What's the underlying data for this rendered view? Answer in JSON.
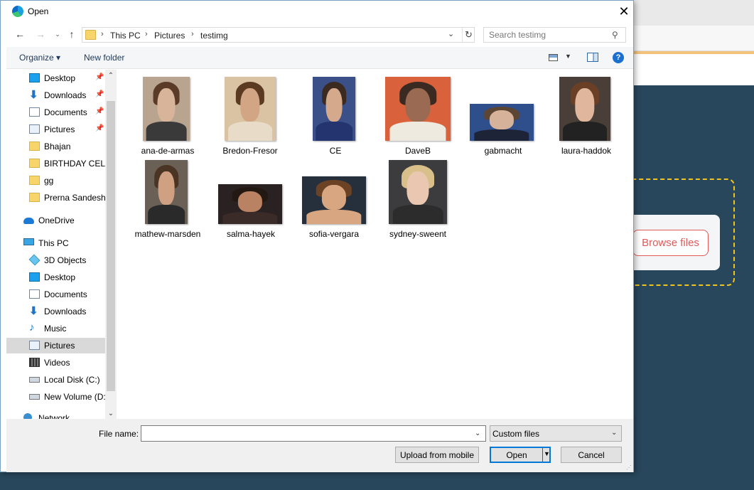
{
  "dialog": {
    "title": "Open",
    "close_glyph": "✕"
  },
  "nav": {
    "back_glyph": "←",
    "forward_glyph": "→",
    "recent_glyph": "⌄",
    "up_glyph": "↑",
    "breadcrumb": [
      "This PC",
      "Pictures",
      "testimg"
    ],
    "separator": "›",
    "dropdown_glyph": "⌄",
    "refresh_glyph": "↻",
    "search_placeholder": "Search testimg",
    "search_glyph": "⚲"
  },
  "toolbar": {
    "organize_label": "Organize ▾",
    "new_folder_label": "New folder",
    "view_dropdown_glyph": "▼",
    "help_glyph": "?"
  },
  "sidebar": {
    "pin_glyph": "📌",
    "items": [
      {
        "label": "Desktop",
        "icon": "desktop-icon",
        "pinned": true
      },
      {
        "label": "Downloads",
        "icon": "downloads-icon",
        "pinned": true
      },
      {
        "label": "Documents",
        "icon": "documents-icon",
        "pinned": true
      },
      {
        "label": "Pictures",
        "icon": "pictures-icon",
        "pinned": true
      },
      {
        "label": "Bhajan",
        "icon": "folder-icon",
        "pinned": false
      },
      {
        "label": "BIRTHDAY CELEB",
        "icon": "folder-icon",
        "pinned": false
      },
      {
        "label": "gg",
        "icon": "folder-icon",
        "pinned": false
      },
      {
        "label": "Prerna Sandesh_",
        "icon": "folder-icon",
        "pinned": false
      },
      {
        "label": "OneDrive",
        "icon": "onedrive-icon",
        "pinned": false
      },
      {
        "label": "This PC",
        "icon": "this-pc-icon",
        "pinned": false
      },
      {
        "label": "3D Objects",
        "icon": "3d-objects-icon",
        "pinned": false
      },
      {
        "label": "Desktop",
        "icon": "desktop-icon",
        "pinned": false
      },
      {
        "label": "Documents",
        "icon": "documents-icon",
        "pinned": false
      },
      {
        "label": "Downloads",
        "icon": "downloads-icon",
        "pinned": false
      },
      {
        "label": "Music",
        "icon": "music-icon",
        "pinned": false
      },
      {
        "label": "Pictures",
        "icon": "pictures-icon",
        "pinned": false,
        "selected": true
      },
      {
        "label": "Videos",
        "icon": "videos-icon",
        "pinned": false
      },
      {
        "label": "Local Disk (C:)",
        "icon": "local-disk-icon",
        "pinned": false
      },
      {
        "label": "New Volume (D:",
        "icon": "volume-icon",
        "pinned": false
      },
      {
        "label": "Network",
        "icon": "network-icon",
        "pinned": false
      }
    ],
    "scroll_up_glyph": "⌃",
    "scroll_down_glyph": "⌄"
  },
  "files": [
    {
      "name": "ana-de-armas",
      "skin": "#d8b49a",
      "hair": "#5a3b28",
      "bg": "#b9a58f",
      "cloth": "#3a3a3a"
    },
    {
      "name": "Bredon-Fresor",
      "skin": "#d2a584",
      "hair": "#5b3a22",
      "bg": "#d9c3a3",
      "cloth": "#e8dcc8"
    },
    {
      "name": "CE",
      "skin": "#d4a98c",
      "hair": "#3b2a20",
      "bg": "#3b4f88",
      "cloth": "#23346f"
    },
    {
      "name": "DaveB",
      "skin": "#9a6b52",
      "hair": "#3a2a22",
      "bg": "#d9623c",
      "cloth": "#eeeadf"
    },
    {
      "name": "gabmacht",
      "skin": "#d7b29a",
      "hair": "#5c4633",
      "bg": "#2f4f8c",
      "cloth": "#1d2438"
    },
    {
      "name": "laura-haddok",
      "skin": "#e0b79d",
      "hair": "#6a3f26",
      "bg": "#4a3f38",
      "cloth": "#222"
    },
    {
      "name": "mathew-marsden",
      "skin": "#cfa081",
      "hair": "#4a3424",
      "bg": "#6a6055",
      "cloth": "#2a2a2a"
    },
    {
      "name": "salma-hayek",
      "skin": "#b98262",
      "hair": "#241812",
      "bg": "#2a2222",
      "cloth": "#3a2a28"
    },
    {
      "name": "sofia-vergara",
      "skin": "#d8a680",
      "hair": "#6b4223",
      "bg": "#26303c",
      "cloth": "#d8a680"
    },
    {
      "name": "sydney-sweent",
      "skin": "#e9c7b0",
      "hair": "#d9c08a",
      "bg": "#3c3c3e",
      "cloth": "#2c2c2c"
    }
  ],
  "bottom": {
    "filename_label": "File name:",
    "filename_value": "",
    "dropdown_glyph": "⌄",
    "filetype_label": "Custom files",
    "upload_mobile_label": "Upload from mobile",
    "open_label": "Open",
    "open_dropdown_glyph": "▼",
    "cancel_label": "Cancel",
    "grip_glyph": "⋰"
  },
  "background_page": {
    "browse_files_label": "Browse files"
  }
}
